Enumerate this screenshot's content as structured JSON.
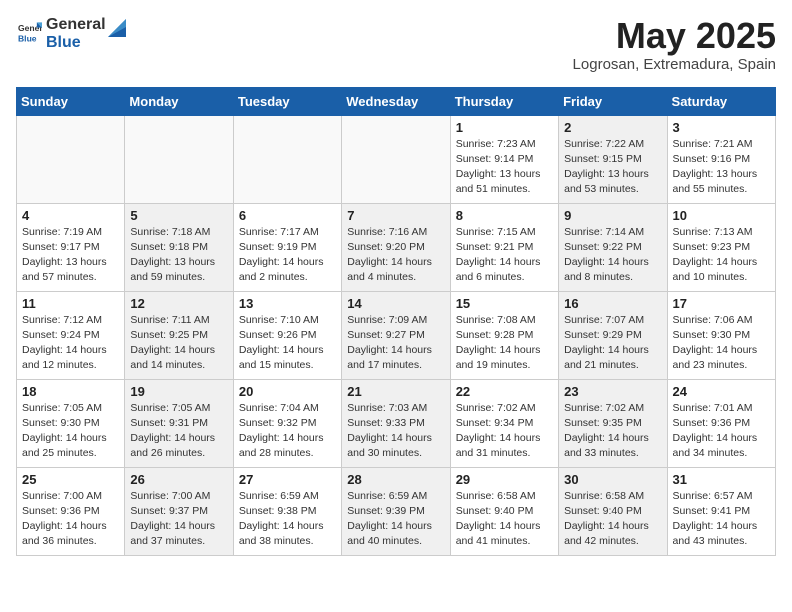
{
  "header": {
    "logo_line1": "General",
    "logo_line2": "Blue",
    "month_title": "May 2025",
    "location": "Logrosan, Extremadura, Spain"
  },
  "weekdays": [
    "Sunday",
    "Monday",
    "Tuesday",
    "Wednesday",
    "Thursday",
    "Friday",
    "Saturday"
  ],
  "weeks": [
    [
      {
        "day": "",
        "info": "",
        "shaded": false,
        "empty": true
      },
      {
        "day": "",
        "info": "",
        "shaded": false,
        "empty": true
      },
      {
        "day": "",
        "info": "",
        "shaded": false,
        "empty": true
      },
      {
        "day": "",
        "info": "",
        "shaded": false,
        "empty": true
      },
      {
        "day": "1",
        "info": "Sunrise: 7:23 AM\nSunset: 9:14 PM\nDaylight: 13 hours\nand 51 minutes.",
        "shaded": false,
        "empty": false
      },
      {
        "day": "2",
        "info": "Sunrise: 7:22 AM\nSunset: 9:15 PM\nDaylight: 13 hours\nand 53 minutes.",
        "shaded": true,
        "empty": false
      },
      {
        "day": "3",
        "info": "Sunrise: 7:21 AM\nSunset: 9:16 PM\nDaylight: 13 hours\nand 55 minutes.",
        "shaded": false,
        "empty": false
      }
    ],
    [
      {
        "day": "4",
        "info": "Sunrise: 7:19 AM\nSunset: 9:17 PM\nDaylight: 13 hours\nand 57 minutes.",
        "shaded": false,
        "empty": false
      },
      {
        "day": "5",
        "info": "Sunrise: 7:18 AM\nSunset: 9:18 PM\nDaylight: 13 hours\nand 59 minutes.",
        "shaded": true,
        "empty": false
      },
      {
        "day": "6",
        "info": "Sunrise: 7:17 AM\nSunset: 9:19 PM\nDaylight: 14 hours\nand 2 minutes.",
        "shaded": false,
        "empty": false
      },
      {
        "day": "7",
        "info": "Sunrise: 7:16 AM\nSunset: 9:20 PM\nDaylight: 14 hours\nand 4 minutes.",
        "shaded": true,
        "empty": false
      },
      {
        "day": "8",
        "info": "Sunrise: 7:15 AM\nSunset: 9:21 PM\nDaylight: 14 hours\nand 6 minutes.",
        "shaded": false,
        "empty": false
      },
      {
        "day": "9",
        "info": "Sunrise: 7:14 AM\nSunset: 9:22 PM\nDaylight: 14 hours\nand 8 minutes.",
        "shaded": true,
        "empty": false
      },
      {
        "day": "10",
        "info": "Sunrise: 7:13 AM\nSunset: 9:23 PM\nDaylight: 14 hours\nand 10 minutes.",
        "shaded": false,
        "empty": false
      }
    ],
    [
      {
        "day": "11",
        "info": "Sunrise: 7:12 AM\nSunset: 9:24 PM\nDaylight: 14 hours\nand 12 minutes.",
        "shaded": false,
        "empty": false
      },
      {
        "day": "12",
        "info": "Sunrise: 7:11 AM\nSunset: 9:25 PM\nDaylight: 14 hours\nand 14 minutes.",
        "shaded": true,
        "empty": false
      },
      {
        "day": "13",
        "info": "Sunrise: 7:10 AM\nSunset: 9:26 PM\nDaylight: 14 hours\nand 15 minutes.",
        "shaded": false,
        "empty": false
      },
      {
        "day": "14",
        "info": "Sunrise: 7:09 AM\nSunset: 9:27 PM\nDaylight: 14 hours\nand 17 minutes.",
        "shaded": true,
        "empty": false
      },
      {
        "day": "15",
        "info": "Sunrise: 7:08 AM\nSunset: 9:28 PM\nDaylight: 14 hours\nand 19 minutes.",
        "shaded": false,
        "empty": false
      },
      {
        "day": "16",
        "info": "Sunrise: 7:07 AM\nSunset: 9:29 PM\nDaylight: 14 hours\nand 21 minutes.",
        "shaded": true,
        "empty": false
      },
      {
        "day": "17",
        "info": "Sunrise: 7:06 AM\nSunset: 9:30 PM\nDaylight: 14 hours\nand 23 minutes.",
        "shaded": false,
        "empty": false
      }
    ],
    [
      {
        "day": "18",
        "info": "Sunrise: 7:05 AM\nSunset: 9:30 PM\nDaylight: 14 hours\nand 25 minutes.",
        "shaded": false,
        "empty": false
      },
      {
        "day": "19",
        "info": "Sunrise: 7:05 AM\nSunset: 9:31 PM\nDaylight: 14 hours\nand 26 minutes.",
        "shaded": true,
        "empty": false
      },
      {
        "day": "20",
        "info": "Sunrise: 7:04 AM\nSunset: 9:32 PM\nDaylight: 14 hours\nand 28 minutes.",
        "shaded": false,
        "empty": false
      },
      {
        "day": "21",
        "info": "Sunrise: 7:03 AM\nSunset: 9:33 PM\nDaylight: 14 hours\nand 30 minutes.",
        "shaded": true,
        "empty": false
      },
      {
        "day": "22",
        "info": "Sunrise: 7:02 AM\nSunset: 9:34 PM\nDaylight: 14 hours\nand 31 minutes.",
        "shaded": false,
        "empty": false
      },
      {
        "day": "23",
        "info": "Sunrise: 7:02 AM\nSunset: 9:35 PM\nDaylight: 14 hours\nand 33 minutes.",
        "shaded": true,
        "empty": false
      },
      {
        "day": "24",
        "info": "Sunrise: 7:01 AM\nSunset: 9:36 PM\nDaylight: 14 hours\nand 34 minutes.",
        "shaded": false,
        "empty": false
      }
    ],
    [
      {
        "day": "25",
        "info": "Sunrise: 7:00 AM\nSunset: 9:36 PM\nDaylight: 14 hours\nand 36 minutes.",
        "shaded": false,
        "empty": false
      },
      {
        "day": "26",
        "info": "Sunrise: 7:00 AM\nSunset: 9:37 PM\nDaylight: 14 hours\nand 37 minutes.",
        "shaded": true,
        "empty": false
      },
      {
        "day": "27",
        "info": "Sunrise: 6:59 AM\nSunset: 9:38 PM\nDaylight: 14 hours\nand 38 minutes.",
        "shaded": false,
        "empty": false
      },
      {
        "day": "28",
        "info": "Sunrise: 6:59 AM\nSunset: 9:39 PM\nDaylight: 14 hours\nand 40 minutes.",
        "shaded": true,
        "empty": false
      },
      {
        "day": "29",
        "info": "Sunrise: 6:58 AM\nSunset: 9:40 PM\nDaylight: 14 hours\nand 41 minutes.",
        "shaded": false,
        "empty": false
      },
      {
        "day": "30",
        "info": "Sunrise: 6:58 AM\nSunset: 9:40 PM\nDaylight: 14 hours\nand 42 minutes.",
        "shaded": true,
        "empty": false
      },
      {
        "day": "31",
        "info": "Sunrise: 6:57 AM\nSunset: 9:41 PM\nDaylight: 14 hours\nand 43 minutes.",
        "shaded": false,
        "empty": false
      }
    ]
  ]
}
